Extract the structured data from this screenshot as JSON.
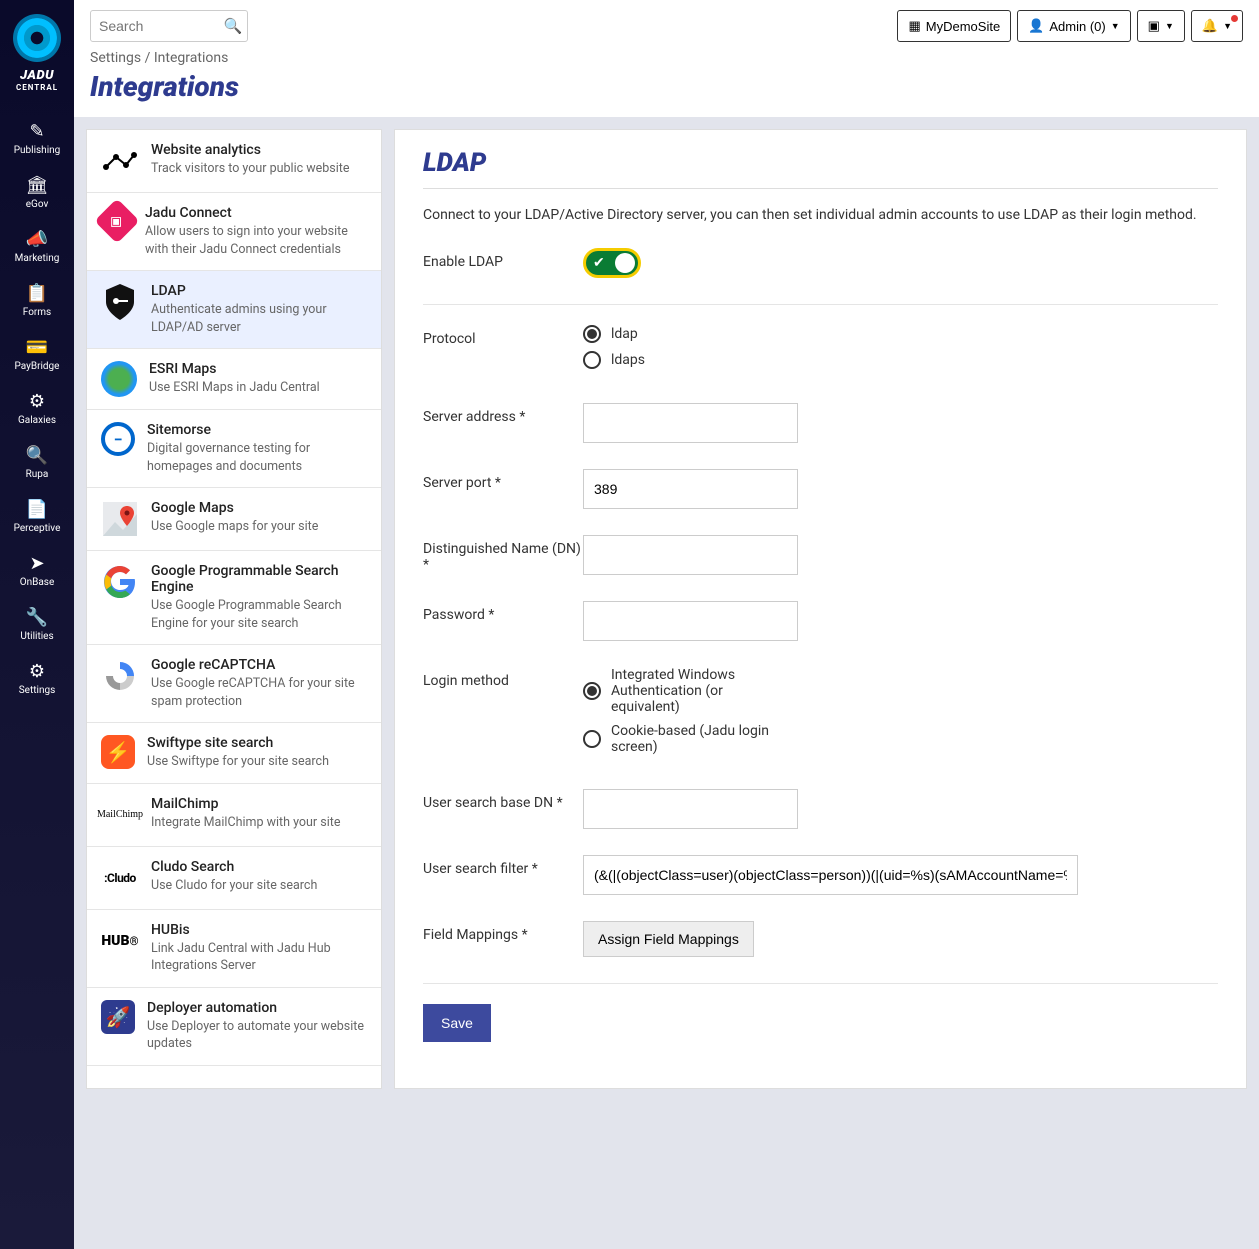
{
  "brand": {
    "name": "JADU",
    "sub": "CENTRAL"
  },
  "nav": [
    {
      "label": "Publishing"
    },
    {
      "label": "eGov"
    },
    {
      "label": "Marketing"
    },
    {
      "label": "Forms"
    },
    {
      "label": "PayBridge"
    },
    {
      "label": "Galaxies"
    },
    {
      "label": "Rupa"
    },
    {
      "label": "Perceptive"
    },
    {
      "label": "OnBase"
    },
    {
      "label": "Utilities"
    },
    {
      "label": "Settings"
    }
  ],
  "search": {
    "placeholder": "Search"
  },
  "topbar": {
    "site": "MyDemoSite",
    "admin": "Admin (0)"
  },
  "crumbs": {
    "root": "Settings",
    "sep": "/",
    "current": "Integrations"
  },
  "page_title": "Integrations",
  "integrations": [
    {
      "title": "Website analytics",
      "desc": "Track visitors to your public website"
    },
    {
      "title": "Jadu Connect",
      "desc": "Allow users to sign into your website with their Jadu Connect credentials"
    },
    {
      "title": "LDAP",
      "desc": "Authenticate admins using your LDAP/AD server"
    },
    {
      "title": "ESRI Maps",
      "desc": "Use ESRI Maps in Jadu Central"
    },
    {
      "title": "Sitemorse",
      "desc": "Digital governance testing for homepages and documents"
    },
    {
      "title": "Google Maps",
      "desc": "Use Google maps for your site"
    },
    {
      "title": "Google Programmable Search Engine",
      "desc": "Use Google Programmable Search Engine for your site search"
    },
    {
      "title": "Google reCAPTCHA",
      "desc": "Use Google reCAPTCHA for your site spam protection"
    },
    {
      "title": "Swiftype site search",
      "desc": "Use Swiftype for your site search"
    },
    {
      "title": "MailChimp",
      "desc": "Integrate MailChimp with your site"
    },
    {
      "title": "Cludo Search",
      "desc": "Use Cludo for your site search"
    },
    {
      "title": "HUBis",
      "desc": "Link Jadu Central with Jadu Hub Integrations Server"
    },
    {
      "title": "Deployer automation",
      "desc": "Use Deployer to automate your website updates"
    }
  ],
  "panel": {
    "title": "LDAP",
    "desc": "Connect to your LDAP/Active Directory server, you can then set individual admin accounts to use LDAP as their login method.",
    "labels": {
      "enable": "Enable LDAP",
      "protocol": "Protocol",
      "server_address": "Server address",
      "server_port": "Server port",
      "dn": "Distinguished Name (DN)",
      "password": "Password",
      "login_method": "Login method",
      "search_base": "User search base DN",
      "search_filter": "User search filter",
      "field_mappings": "Field Mappings"
    },
    "protocol_opts": {
      "ldap": "ldap",
      "ldaps": "ldaps"
    },
    "login_opts": {
      "iwa": "Integrated Windows Authentication (or equivalent)",
      "cookie": "Cookie-based (Jadu login screen)"
    },
    "values": {
      "server_port": "389",
      "search_filter": "(&(|(objectClass=user)(objectClass=person))(|(uid=%s)(sAMAccountName=%s)(cn="
    },
    "assign_btn": "Assign Field Mappings",
    "save": "Save"
  }
}
